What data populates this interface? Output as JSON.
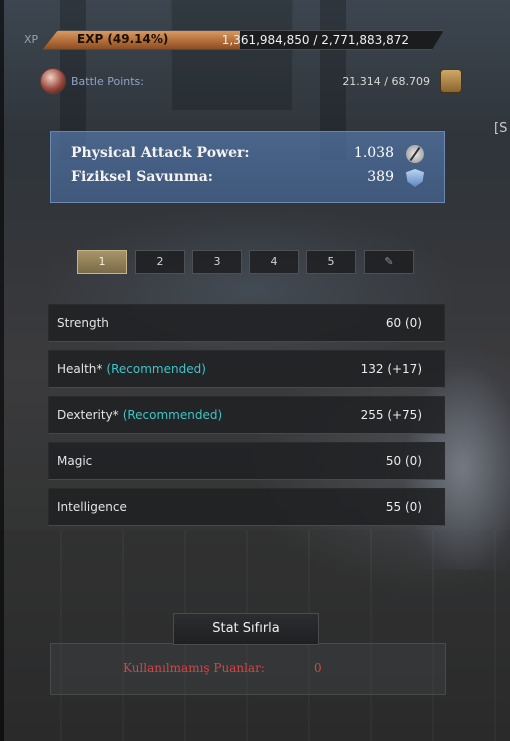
{
  "xp": {
    "label": "XP",
    "exp_text": "EXP (49.14%)",
    "progress_fraction": 0.4914,
    "values": "1,361,984,850 / 2,771,883,872"
  },
  "battle_points": {
    "label": "Battle Points:",
    "value": "21.314 / 68.709",
    "icon": "skull-icon",
    "action_icon": "scroll-icon"
  },
  "side_marker": "[S",
  "combat": [
    {
      "label": "Physical Attack Power:",
      "value": "1.038",
      "icon": "sword-icon"
    },
    {
      "label": "Fiziksel Savunma:",
      "value": "389",
      "icon": "shield-icon"
    }
  ],
  "tabs": [
    {
      "label": "1",
      "active": true
    },
    {
      "label": "2",
      "active": false
    },
    {
      "label": "3",
      "active": false
    },
    {
      "label": "4",
      "active": false
    },
    {
      "label": "5",
      "active": false
    },
    {
      "label": "✎",
      "active": false,
      "icon": "feather-icon"
    }
  ],
  "stats": [
    {
      "name": "Strength",
      "recommended": "",
      "value": "60 (0)"
    },
    {
      "name": "Health*",
      "recommended": "(Recommended)",
      "value": "132 (+17)"
    },
    {
      "name": "Dexterity*",
      "recommended": "(Recommended)",
      "value": "255 (+75)"
    },
    {
      "name": "Magic",
      "recommended": "",
      "value": "50 (0)"
    },
    {
      "name": "Intelligence",
      "recommended": "",
      "value": "55 (0)"
    }
  ],
  "reset_button": "Stat Sıfırla",
  "unused_points": {
    "label": "Kullanılmamış Puanlar:",
    "value": "0"
  },
  "colors": {
    "accent_exp": "#c07c45",
    "recommended": "#3ec4c9",
    "unused_points": "#d64545",
    "combat_box": "#5577aa"
  }
}
